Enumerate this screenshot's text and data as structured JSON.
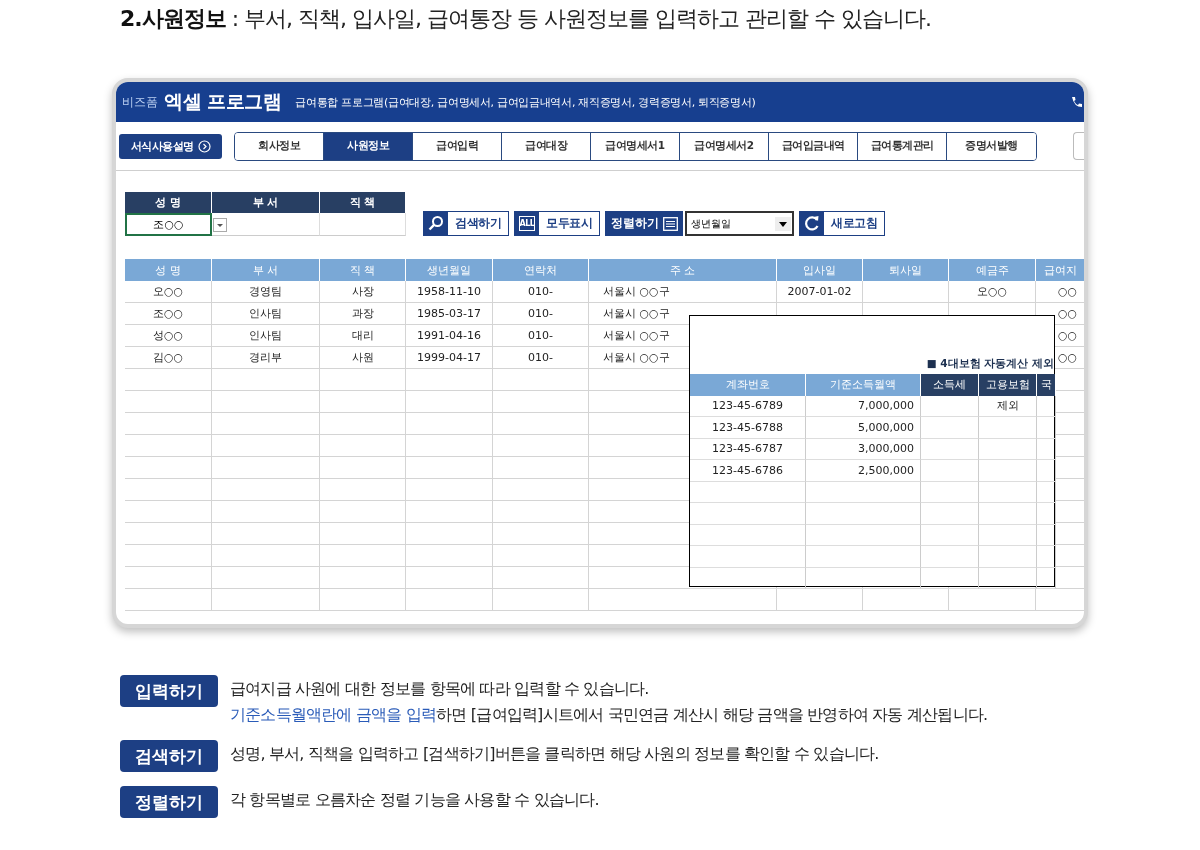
{
  "heading": "**2.사원정보** : 부서, 직책, 입사일, 급여통장 등 사원정보를 입력하고 관리할 수 있습니다.",
  "app": {
    "brand_small": "비즈폼",
    "brand": "엑셀 프로그램",
    "subtitle": "급여통합 프로그램(급여대장, 급여명세서, 급여입금내역서, 재직증명서, 경력증명서, 퇴직증명서)",
    "guide_button": "서식사용설명",
    "tabs": [
      {
        "label": "회사정보",
        "selected": false
      },
      {
        "label": "사원정보",
        "selected": true
      },
      {
        "label": "급여입력",
        "selected": false
      },
      {
        "label": "급여대장",
        "selected": false
      },
      {
        "label": "급여명세서1",
        "selected": false
      },
      {
        "label": "급여명세서2",
        "selected": false
      },
      {
        "label": "급여입금내역",
        "selected": false
      },
      {
        "label": "급여통계관리",
        "selected": false
      },
      {
        "label": "증명서발행",
        "selected": false
      }
    ],
    "search": {
      "columns": [
        "성 명",
        "부 서",
        "직 책"
      ],
      "name_value": "조○○"
    },
    "toolbar": [
      {
        "kind": "search",
        "label": "검색하기"
      },
      {
        "kind": "all",
        "label": "모두표시",
        "icon_text": "ALL"
      },
      {
        "kind": "sort",
        "label": "정렬하기"
      },
      {
        "kind": "select",
        "value": "생년월일"
      },
      {
        "kind": "refresh",
        "label": "새로고침"
      }
    ],
    "table": {
      "columns": [
        "성 명",
        "부 서",
        "직 책",
        "생년월일",
        "연락처",
        "주 소",
        "입사일",
        "퇴사일",
        "예금주",
        "급여지"
      ],
      "rows": [
        {
          "cells": [
            "오○○",
            "경영팀",
            "사장",
            "1958-11-10",
            "010-",
            "서울시 ○○구",
            "2007-01-02",
            null,
            "오○○",
            "○○"
          ]
        },
        {
          "cells": [
            "조○○",
            "인사팀",
            "과장",
            "1985-03-17",
            "010-",
            "서울시 ○○구",
            null,
            null,
            null,
            "○○"
          ]
        },
        {
          "cells": [
            "성○○",
            "인사팀",
            "대리",
            "1991-04-16",
            "010-",
            "서울시 ○○구",
            null,
            null,
            null,
            "○○"
          ]
        },
        {
          "cells": [
            "김○○",
            "경리부",
            "사원",
            "1999-04-17",
            "010-",
            "서울시 ○○구",
            null,
            null,
            null,
            "○○"
          ]
        }
      ]
    },
    "popup": {
      "note": "■ 4대보험 자동계산 제외",
      "columns": [
        {
          "label": "계좌번호",
          "kind": "light"
        },
        {
          "label": "기준소득월액",
          "kind": "light"
        },
        {
          "label": "소득세",
          "kind": "dark"
        },
        {
          "label": "고용보험",
          "kind": "dark"
        },
        {
          "label": "국",
          "kind": "dark"
        }
      ],
      "rows": [
        {
          "cells": [
            "123-45-6789",
            "7,000,000",
            null,
            "제외",
            null
          ]
        },
        {
          "cells": [
            "123-45-6788",
            "5,000,000",
            null,
            null,
            null
          ]
        },
        {
          "cells": [
            "123-45-6787",
            "3,000,000",
            null,
            null,
            null
          ]
        },
        {
          "cells": [
            "123-45-6786",
            "2,500,000",
            null,
            null,
            null
          ]
        }
      ]
    }
  },
  "notes": [
    {
      "label": "입력하기",
      "lines": [
        [
          {
            "text": "급여지급 사원에 대한 정보를 항목에 따라 입력할 수 있습니다.",
            "highlight": false
          }
        ],
        [
          {
            "text": "기준소득월액란에 금액을 입력",
            "highlight": true
          },
          {
            "text": "하면 [급여입력]시트에서 국민연금 계산시 해당 금액을 반영하여 자동 계산됩니다.",
            "highlight": false
          }
        ]
      ]
    },
    {
      "label": "검색하기",
      "lines": [
        [
          {
            "text": "성명, 부서, 직책을 입력하고 [검색하기]버튼을 클릭하면 해당 사원의 정보를 확인할 수 있습니다.",
            "highlight": false
          }
        ]
      ]
    },
    {
      "label": "정렬하기",
      "lines": [
        [
          {
            "text": "각 항목별로 오름차순 정렬 기능을 사용할 수 있습니다.",
            "highlight": false
          }
        ]
      ]
    }
  ]
}
